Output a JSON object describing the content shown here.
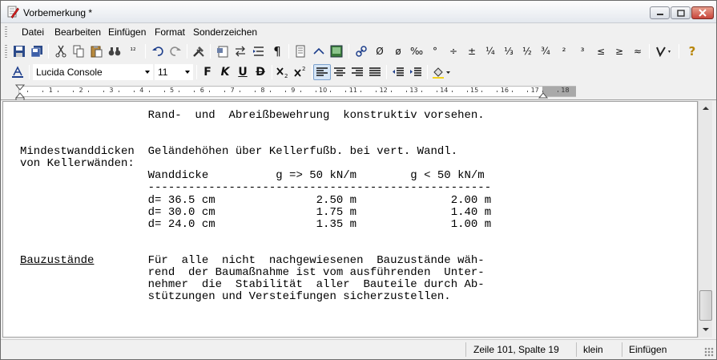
{
  "window": {
    "title": "Vorbemerkung *",
    "icon": "pencil-document-icon"
  },
  "menu": {
    "items": [
      {
        "label": "Datei",
        "key": "D"
      },
      {
        "label": "Bearbeiten",
        "key": "B"
      },
      {
        "label": "Einfügen",
        "key": "E"
      },
      {
        "label": "Format",
        "key": "F"
      },
      {
        "label": "Sonderzeichen",
        "key": "S"
      }
    ]
  },
  "toolbar1": {
    "special_chars": [
      "Ø",
      "ø",
      "‰",
      "°",
      "÷",
      "±",
      "¼",
      "⅓",
      "½",
      "¾",
      "²",
      "³",
      "≤",
      "≥",
      "≈"
    ],
    "help": "?"
  },
  "toolbar2": {
    "font_name": "Lucida Console",
    "font_size": "11",
    "bold": "F",
    "italic": "K",
    "underline": "U",
    "strike": "D"
  },
  "ruler": {
    "numbers": [
      "1",
      "2",
      "3",
      "4",
      "5",
      "6",
      "7",
      "8",
      "9",
      "10",
      "11",
      "12",
      "13",
      "14",
      "15",
      "16",
      "17",
      "18"
    ]
  },
  "document": {
    "lines": [
      "                   Rand-  und  Abreißbewehrung  konstruktiv vorsehen.",
      "",
      "",
      "Mindestwanddicken  Geländehöhen über Kellerfußb. bei vert. Wandl.",
      "von Kellerwänden:",
      "",
      "                   Wanddicke          g => 50 kN/m        g < 50 kN/m",
      "                   ---------------------------------------------------",
      "                   d= 36.5 cm               2.50 m              2.00 m",
      "                   d= 30.0 cm               1.75 m              1.40 m",
      "                   d= 24.0 cm               1.35 m              1.00 m",
      "",
      "",
      "",
      "                   Für  alle  nicht  nachgewiesenen  Bauzustände wäh-",
      "                   rend  der Baumaßnahme ist vom ausführenden  Unter-",
      "                   nehmer  die  Stabilität  aller  Bauteile durch Ab-",
      "                   stützungen und Versteifungen sicherzustellen."
    ],
    "underlined_label": "Bauzustände"
  },
  "status": {
    "position": "Zeile 101, Spalte 19",
    "size": "klein",
    "mode": "Einfügen"
  }
}
